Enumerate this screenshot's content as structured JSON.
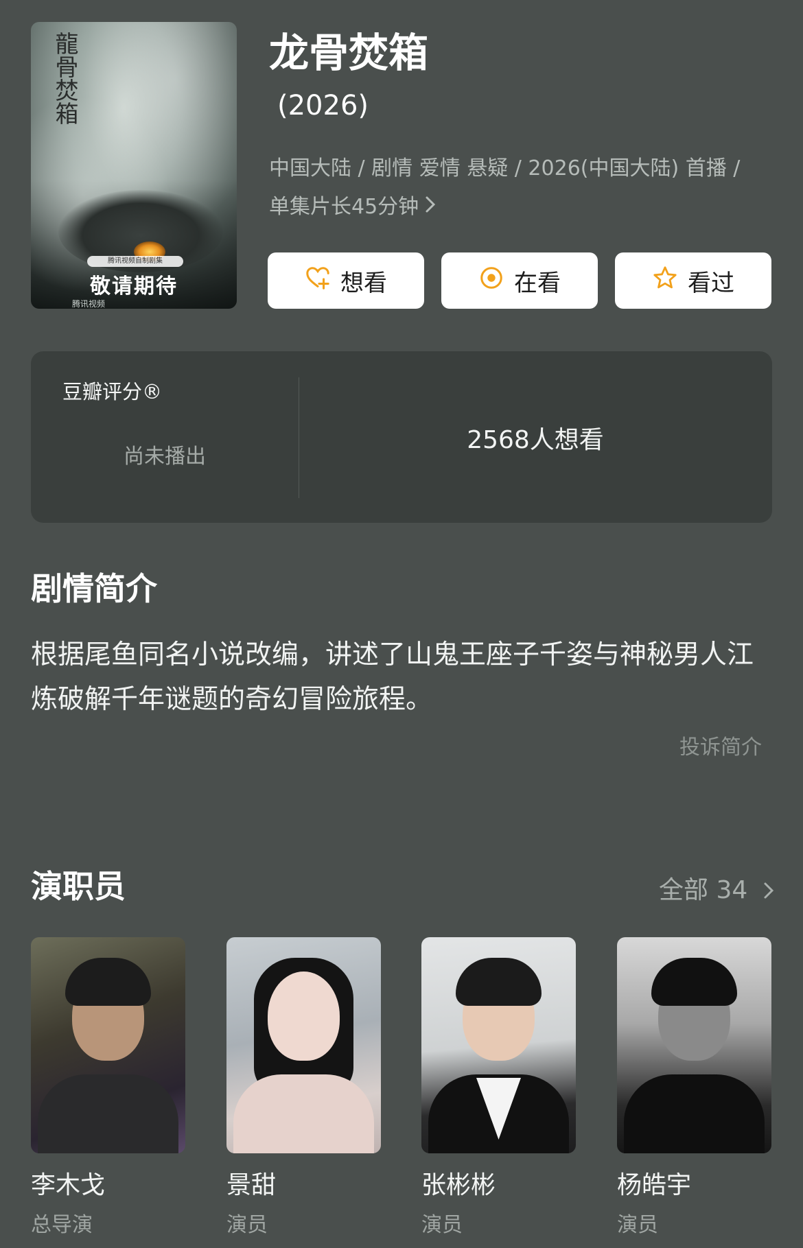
{
  "poster": {
    "calligraphy": "龍骨焚箱",
    "tag": "腾讯视频自制剧集",
    "coming": "敬请期待",
    "logos": "腾讯视频"
  },
  "title": "龙骨焚箱",
  "year": "(2026)",
  "meta": {
    "line1": "中国大陆 / 剧情 爱情 悬疑 / 2026(中国大陆) 首播 /",
    "line2": "单集片长45分钟"
  },
  "actions": [
    {
      "label": "想看",
      "icon": "heart-plus-icon"
    },
    {
      "label": "在看",
      "icon": "record-dot-icon"
    },
    {
      "label": "看过",
      "icon": "star-icon"
    }
  ],
  "rating": {
    "label": "豆瓣评分®",
    "status": "尚未播出",
    "want_count": "2568人想看"
  },
  "synopsis": {
    "heading": "剧情简介",
    "text": "根据尾鱼同名小说改编，讲述了山鬼王座子千姿与神秘男人江炼破解千年谜题的奇幻冒险旅程。",
    "report": "投诉简介"
  },
  "cast": {
    "heading": "演职员",
    "all_label": "全部 34",
    "members": [
      {
        "name": "李木戈",
        "role": "总导演"
      },
      {
        "name": "景甜",
        "role": "演员"
      },
      {
        "name": "张彬彬",
        "role": "演员"
      },
      {
        "name": "杨皓宇",
        "role": "演员"
      }
    ]
  },
  "colors": {
    "background": "#4a4f4d",
    "card": "#3a3f3d",
    "accent": "#f2a11b"
  }
}
